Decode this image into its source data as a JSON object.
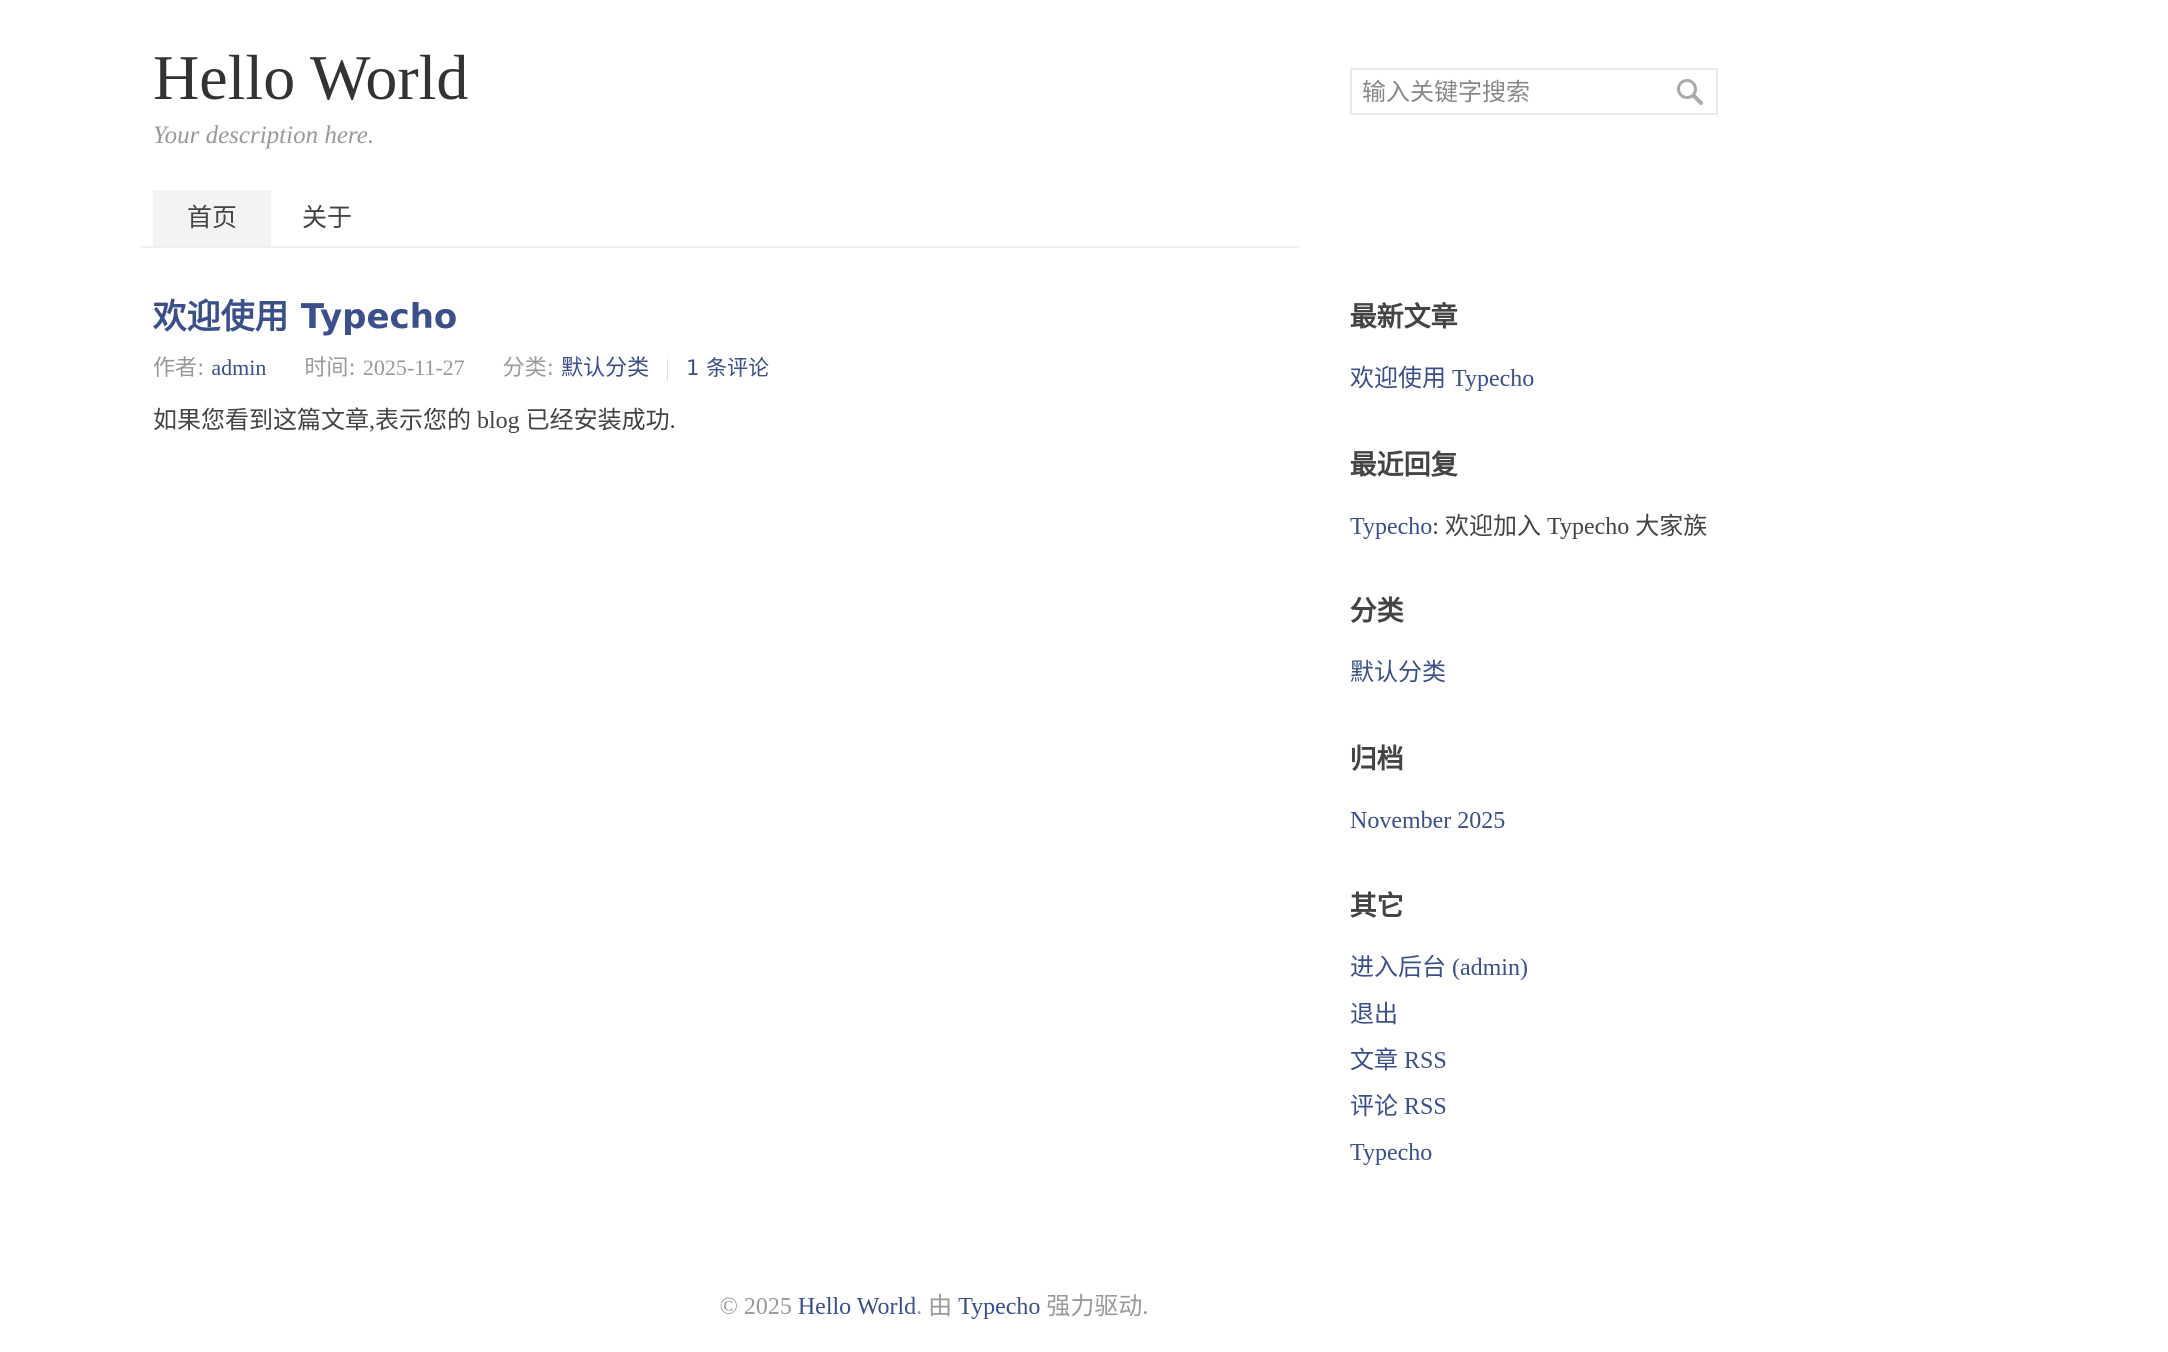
{
  "header": {
    "title": "Hello World",
    "description": "Your description here."
  },
  "search": {
    "placeholder": "输入关键字搜索",
    "value": ""
  },
  "nav": {
    "items": [
      {
        "label": "首页",
        "active": true
      },
      {
        "label": "关于",
        "active": false
      }
    ]
  },
  "post": {
    "title": "欢迎使用 Typecho",
    "author_label": "作者: ",
    "author": "admin",
    "time_label": "时间: ",
    "time": "2025-11-27",
    "category_label": "分类: ",
    "category": "默认分类",
    "comments": "1 条评论",
    "excerpt": "如果您看到这篇文章,表示您的 blog 已经安装成功."
  },
  "sidebar": {
    "recent_posts": {
      "title": "最新文章",
      "items": [
        "欢迎使用 Typecho"
      ]
    },
    "recent_comments": {
      "title": "最近回复",
      "items": [
        {
          "author": "Typecho",
          "text": ": 欢迎加入 Typecho 大家族"
        }
      ]
    },
    "categories": {
      "title": "分类",
      "items": [
        "默认分类"
      ]
    },
    "archives": {
      "title": "归档",
      "items": [
        "November 2025"
      ]
    },
    "other": {
      "title": "其它",
      "items": [
        "进入后台 (admin)",
        "退出",
        "文章 RSS",
        "评论 RSS",
        "Typecho"
      ]
    }
  },
  "footer": {
    "copyright": "© 2025 ",
    "site_link": "Hello World",
    "mid": ". 由 ",
    "typecho_link": "Typecho",
    "tail": " 强力驱动."
  },
  "colors": {
    "link": "#3b4f8a",
    "text": "#444444",
    "muted": "#999999",
    "nav_active_bg": "#f3f3f3"
  }
}
